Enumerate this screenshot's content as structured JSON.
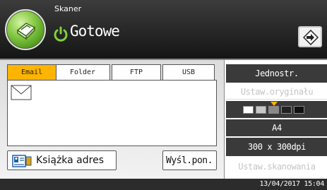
{
  "header": {
    "app_name": "Skaner",
    "status": "Gotowe",
    "icons": {
      "app": "scanner-icon",
      "status": "power-ready-icon",
      "login": "login-arrow-icon"
    }
  },
  "tabs": [
    {
      "label": "Email",
      "active": true
    },
    {
      "label": "Folder",
      "active": false
    },
    {
      "label": "FTP",
      "active": false
    },
    {
      "label": "USB",
      "active": false
    }
  ],
  "destination": {
    "icon": "envelope-icon"
  },
  "buttons": {
    "address_book": "Książka adres",
    "send_later": "Wyśl.pon."
  },
  "right_panel": {
    "simplex": "Jednostr.",
    "original_settings": "Ustaw.oryginału",
    "density_level": 3,
    "density_steps": 5,
    "paper_size": "A4",
    "resolution": "300 x 300dpi",
    "scan_settings": "Ustaw.skanowania"
  },
  "footer": {
    "clock": "13/04/2017 15:04"
  },
  "colors": {
    "accent": "#ffb400",
    "header_bg": "#222222",
    "panel_dark": "#3a3a3a",
    "disabled_text": "#c4c4c4"
  }
}
